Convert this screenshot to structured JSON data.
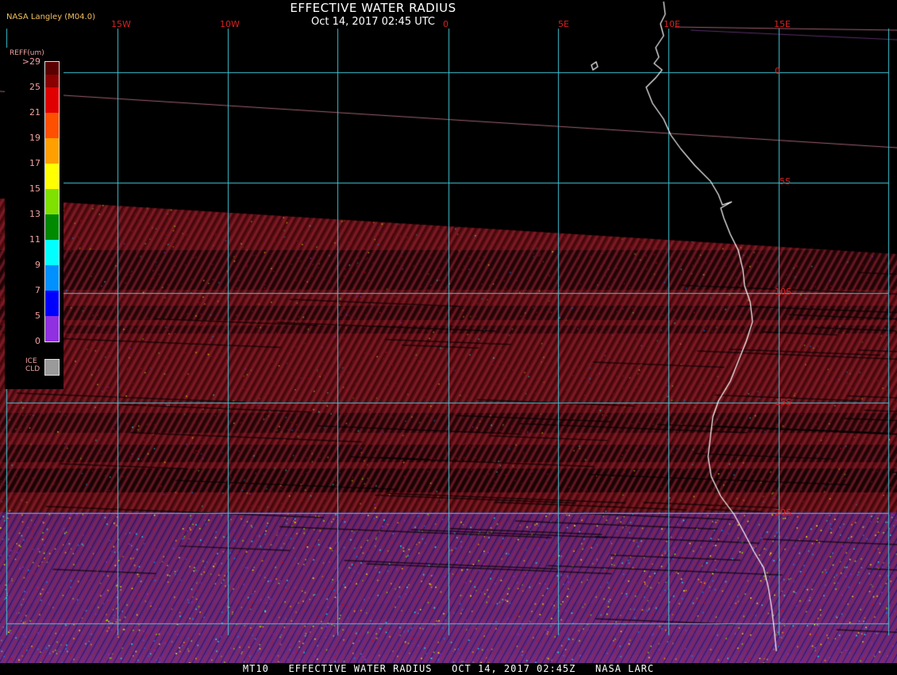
{
  "title": "EFFECTIVE WATER RADIUS",
  "datetime": "Oct 14, 2017 02:45 UTC",
  "producer": "NASA Langley (M04.0)",
  "footer": "MT10   EFFECTIVE WATER RADIUS   OCT 14, 2017 02:45Z   NASA LARC",
  "legend": {
    "title": "REFF(um)",
    "ticks": [
      ">29",
      "25",
      "21",
      "19",
      "17",
      "15",
      "13",
      "11",
      "9",
      "7",
      "5",
      "0"
    ],
    "colors": [
      "#5a0000",
      "#8b0000",
      "#e00000",
      "#ff5000",
      "#ffa000",
      "#ffff00",
      "#80e000",
      "#008a00",
      "#00ffff",
      "#0090ff",
      "#0000ff",
      "#9030e0"
    ],
    "ice_label_1": "ICE",
    "ice_label_2": "CLD",
    "ice_color": "#9a9a9a"
  },
  "grid": {
    "lon_labels": [
      "15W",
      "10W",
      "0",
      "5E",
      "10E",
      "15E"
    ],
    "lat_labels": [
      "0",
      "5S",
      "10S",
      "15S",
      "20S"
    ],
    "line_color": "#40c8d8"
  },
  "cloud_color": "#5a0c10"
}
